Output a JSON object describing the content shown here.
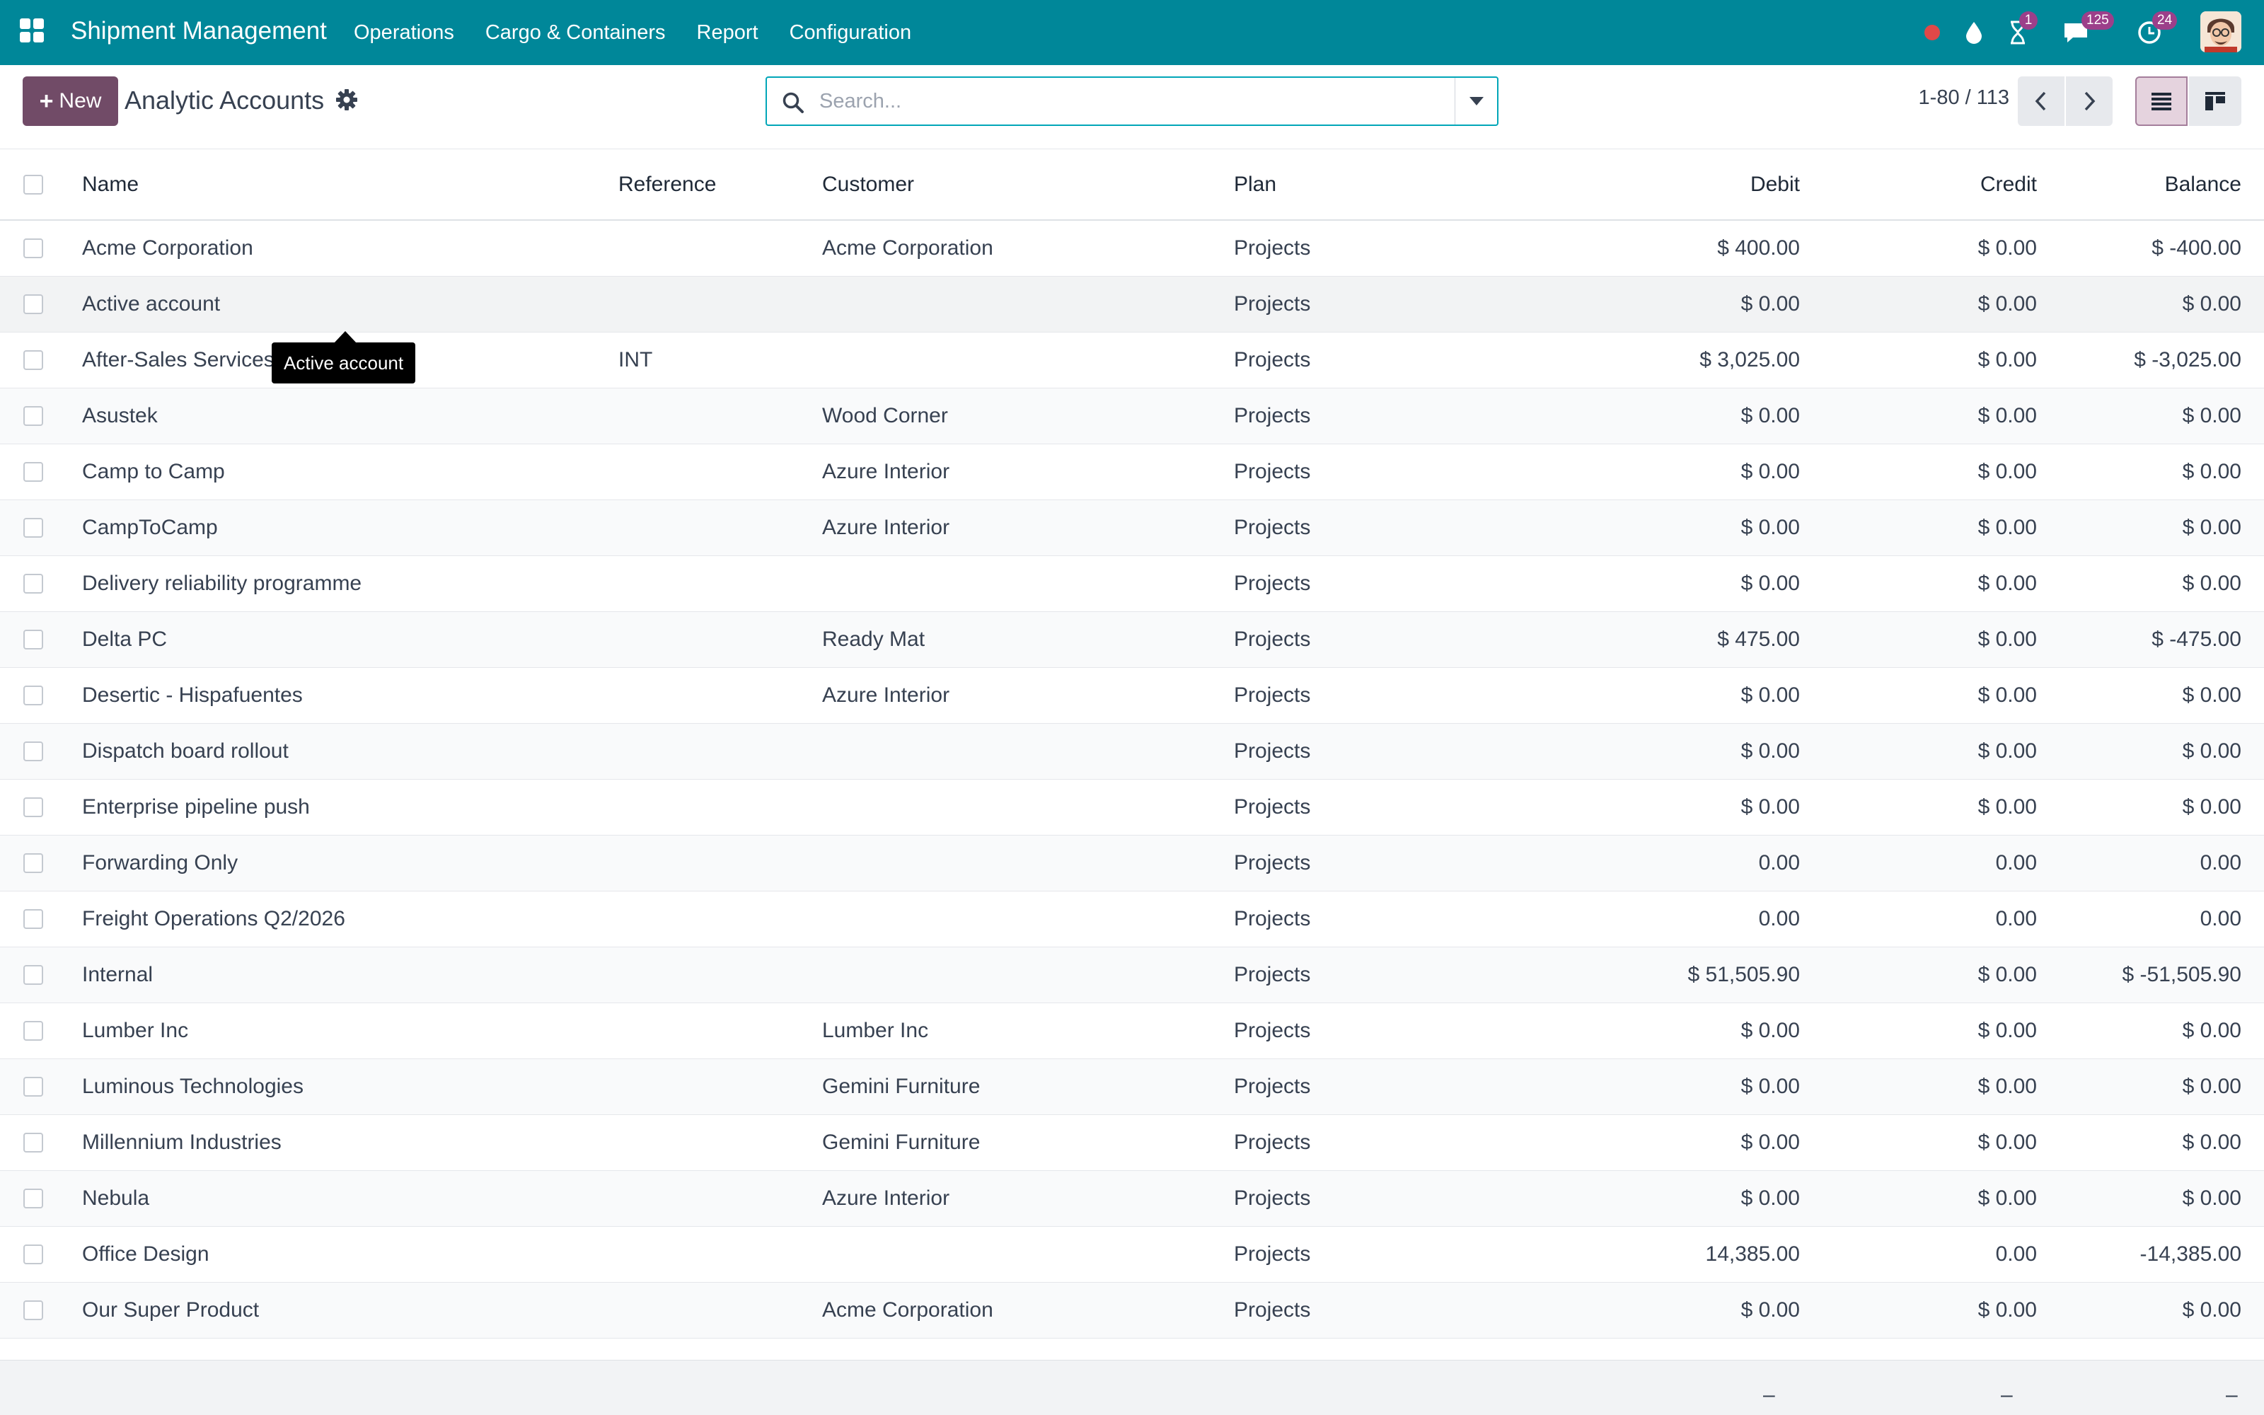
{
  "navbar": {
    "app_name": "Shipment Management",
    "menu": [
      "Operations",
      "Cargo & Containers",
      "Report",
      "Configuration"
    ],
    "activity_badge": "1",
    "messages_badge": "125",
    "updates_badge": "24",
    "brand_color": "#008799"
  },
  "control": {
    "new_label": "New",
    "title": "Analytic Accounts",
    "search_placeholder": "Search...",
    "pager_value": "1-80 / 113",
    "accent_color": "#714b67"
  },
  "table": {
    "columns": {
      "name": "Name",
      "reference": "Reference",
      "customer": "Customer",
      "plan": "Plan",
      "debit": "Debit",
      "credit": "Credit",
      "balance": "Balance"
    },
    "rows": [
      {
        "name": "Acme Corporation",
        "reference": "",
        "customer": "Acme Corporation",
        "plan": "Projects",
        "debit": "$ 400.00",
        "credit": "$ 0.00",
        "balance": "$ -400.00"
      },
      {
        "name": "Active account",
        "reference": "",
        "customer": "",
        "plan": "Projects",
        "debit": "$ 0.00",
        "credit": "$ 0.00",
        "balance": "$ 0.00"
      },
      {
        "name": "After-Sales Services",
        "reference": "INT",
        "customer": "",
        "plan": "Projects",
        "debit": "$ 3,025.00",
        "credit": "$ 0.00",
        "balance": "$ -3,025.00"
      },
      {
        "name": "Asustek",
        "reference": "",
        "customer": "Wood Corner",
        "plan": "Projects",
        "debit": "$ 0.00",
        "credit": "$ 0.00",
        "balance": "$ 0.00"
      },
      {
        "name": "Camp to Camp",
        "reference": "",
        "customer": "Azure Interior",
        "plan": "Projects",
        "debit": "$ 0.00",
        "credit": "$ 0.00",
        "balance": "$ 0.00"
      },
      {
        "name": "CampToCamp",
        "reference": "",
        "customer": "Azure Interior",
        "plan": "Projects",
        "debit": "$ 0.00",
        "credit": "$ 0.00",
        "balance": "$ 0.00"
      },
      {
        "name": "Delivery reliability programme",
        "reference": "",
        "customer": "",
        "plan": "Projects",
        "debit": "$ 0.00",
        "credit": "$ 0.00",
        "balance": "$ 0.00"
      },
      {
        "name": "Delta PC",
        "reference": "",
        "customer": "Ready Mat",
        "plan": "Projects",
        "debit": "$ 475.00",
        "credit": "$ 0.00",
        "balance": "$ -475.00"
      },
      {
        "name": "Desertic - Hispafuentes",
        "reference": "",
        "customer": "Azure Interior",
        "plan": "Projects",
        "debit": "$ 0.00",
        "credit": "$ 0.00",
        "balance": "$ 0.00"
      },
      {
        "name": "Dispatch board rollout",
        "reference": "",
        "customer": "",
        "plan": "Projects",
        "debit": "$ 0.00",
        "credit": "$ 0.00",
        "balance": "$ 0.00"
      },
      {
        "name": "Enterprise pipeline push",
        "reference": "",
        "customer": "",
        "plan": "Projects",
        "debit": "$ 0.00",
        "credit": "$ 0.00",
        "balance": "$ 0.00"
      },
      {
        "name": "Forwarding Only",
        "reference": "",
        "customer": "",
        "plan": "Projects",
        "debit": "0.00",
        "credit": "0.00",
        "balance": "0.00"
      },
      {
        "name": "Freight Operations Q2/2026",
        "reference": "",
        "customer": "",
        "plan": "Projects",
        "debit": "0.00",
        "credit": "0.00",
        "balance": "0.00"
      },
      {
        "name": "Internal",
        "reference": "",
        "customer": "",
        "plan": "Projects",
        "debit": "$ 51,505.90",
        "credit": "$ 0.00",
        "balance": "$ -51,505.90"
      },
      {
        "name": "Lumber Inc",
        "reference": "",
        "customer": "Lumber Inc",
        "plan": "Projects",
        "debit": "$ 0.00",
        "credit": "$ 0.00",
        "balance": "$ 0.00"
      },
      {
        "name": "Luminous Technologies",
        "reference": "",
        "customer": "Gemini Furniture",
        "plan": "Projects",
        "debit": "$ 0.00",
        "credit": "$ 0.00",
        "balance": "$ 0.00"
      },
      {
        "name": "Millennium Industries",
        "reference": "",
        "customer": "Gemini Furniture",
        "plan": "Projects",
        "debit": "$ 0.00",
        "credit": "$ 0.00",
        "balance": "$ 0.00"
      },
      {
        "name": "Nebula",
        "reference": "",
        "customer": "Azure Interior",
        "plan": "Projects",
        "debit": "$ 0.00",
        "credit": "$ 0.00",
        "balance": "$ 0.00"
      },
      {
        "name": "Office Design",
        "reference": "",
        "customer": "",
        "plan": "Projects",
        "debit": "14,385.00",
        "credit": "0.00",
        "balance": "-14,385.00"
      },
      {
        "name": "Our Super Product",
        "reference": "",
        "customer": "Acme Corporation",
        "plan": "Projects",
        "debit": "$ 0.00",
        "credit": "$ 0.00",
        "balance": "$ 0.00"
      }
    ],
    "footer_totals": {
      "debit": "–",
      "credit": "–",
      "balance": "–"
    }
  },
  "tooltip": {
    "text": "Active account"
  }
}
